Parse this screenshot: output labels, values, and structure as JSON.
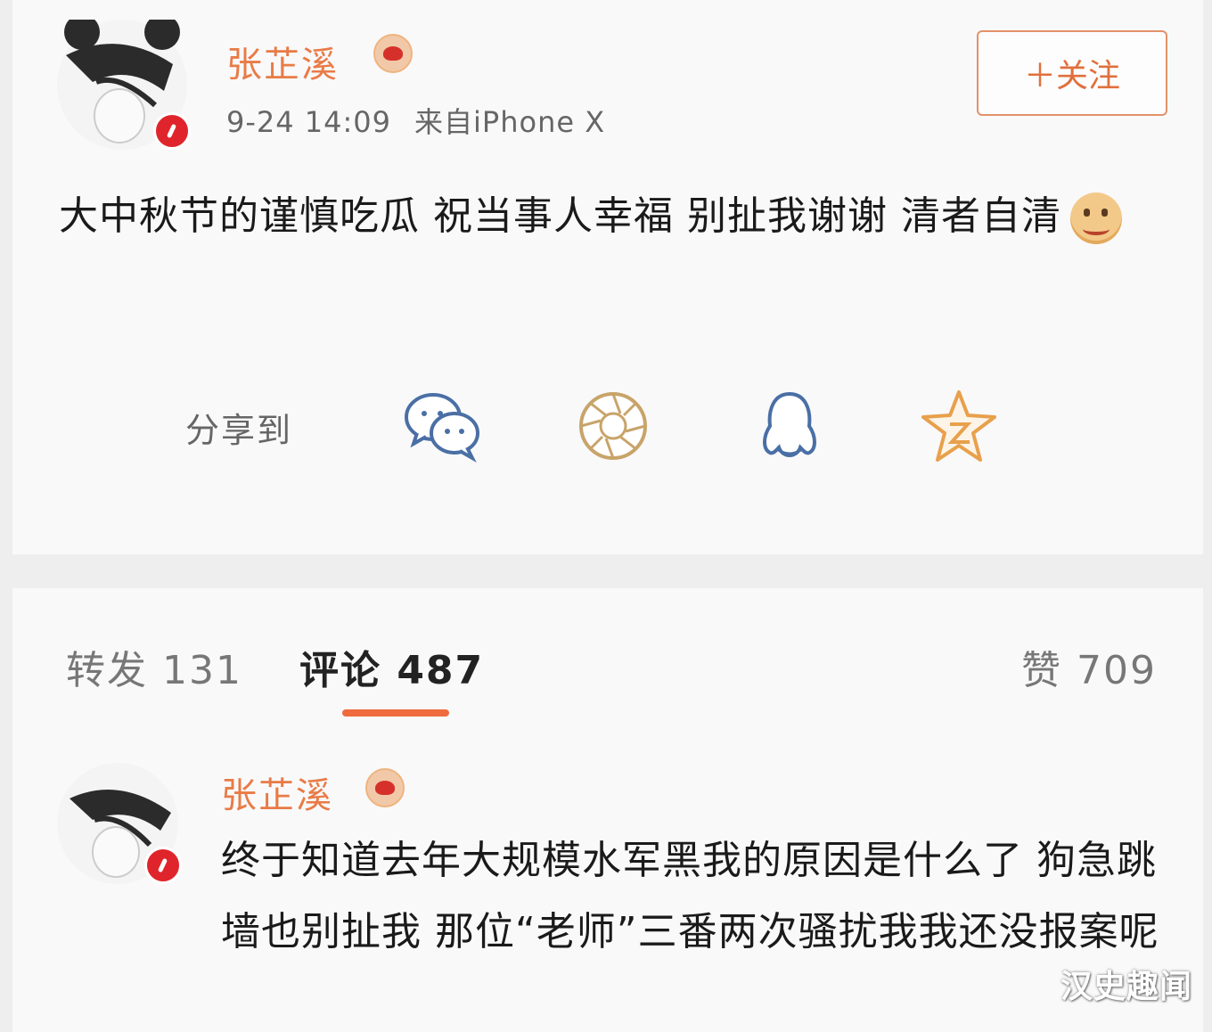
{
  "post": {
    "username": "张芷溪",
    "timestamp": "9-24 14:09",
    "source": "来自iPhone X",
    "follow_label": "＋关注",
    "text": "大中秋节的谨慎吃瓜 祝当事人幸福 别扯我谢谢 清者自清",
    "share_label": "分享到",
    "share_targets": [
      "wechat-icon",
      "moments-icon",
      "qq-icon",
      "qzone-icon"
    ]
  },
  "tabs": {
    "repost": "转发 131",
    "comments": "评论 487",
    "likes": "赞 709"
  },
  "comment": {
    "username": "张芷溪",
    "text": "终于知道去年大规模水军黑我的原因是什么了 狗急跳墙也别扯我 那位“老师”三番两次骚扰我我还没报案呢"
  },
  "watermark": "汉史趣闻",
  "colors": {
    "accent": "#e97b46",
    "tab_underline": "#ef6b3e",
    "verified": "#e0242b"
  }
}
